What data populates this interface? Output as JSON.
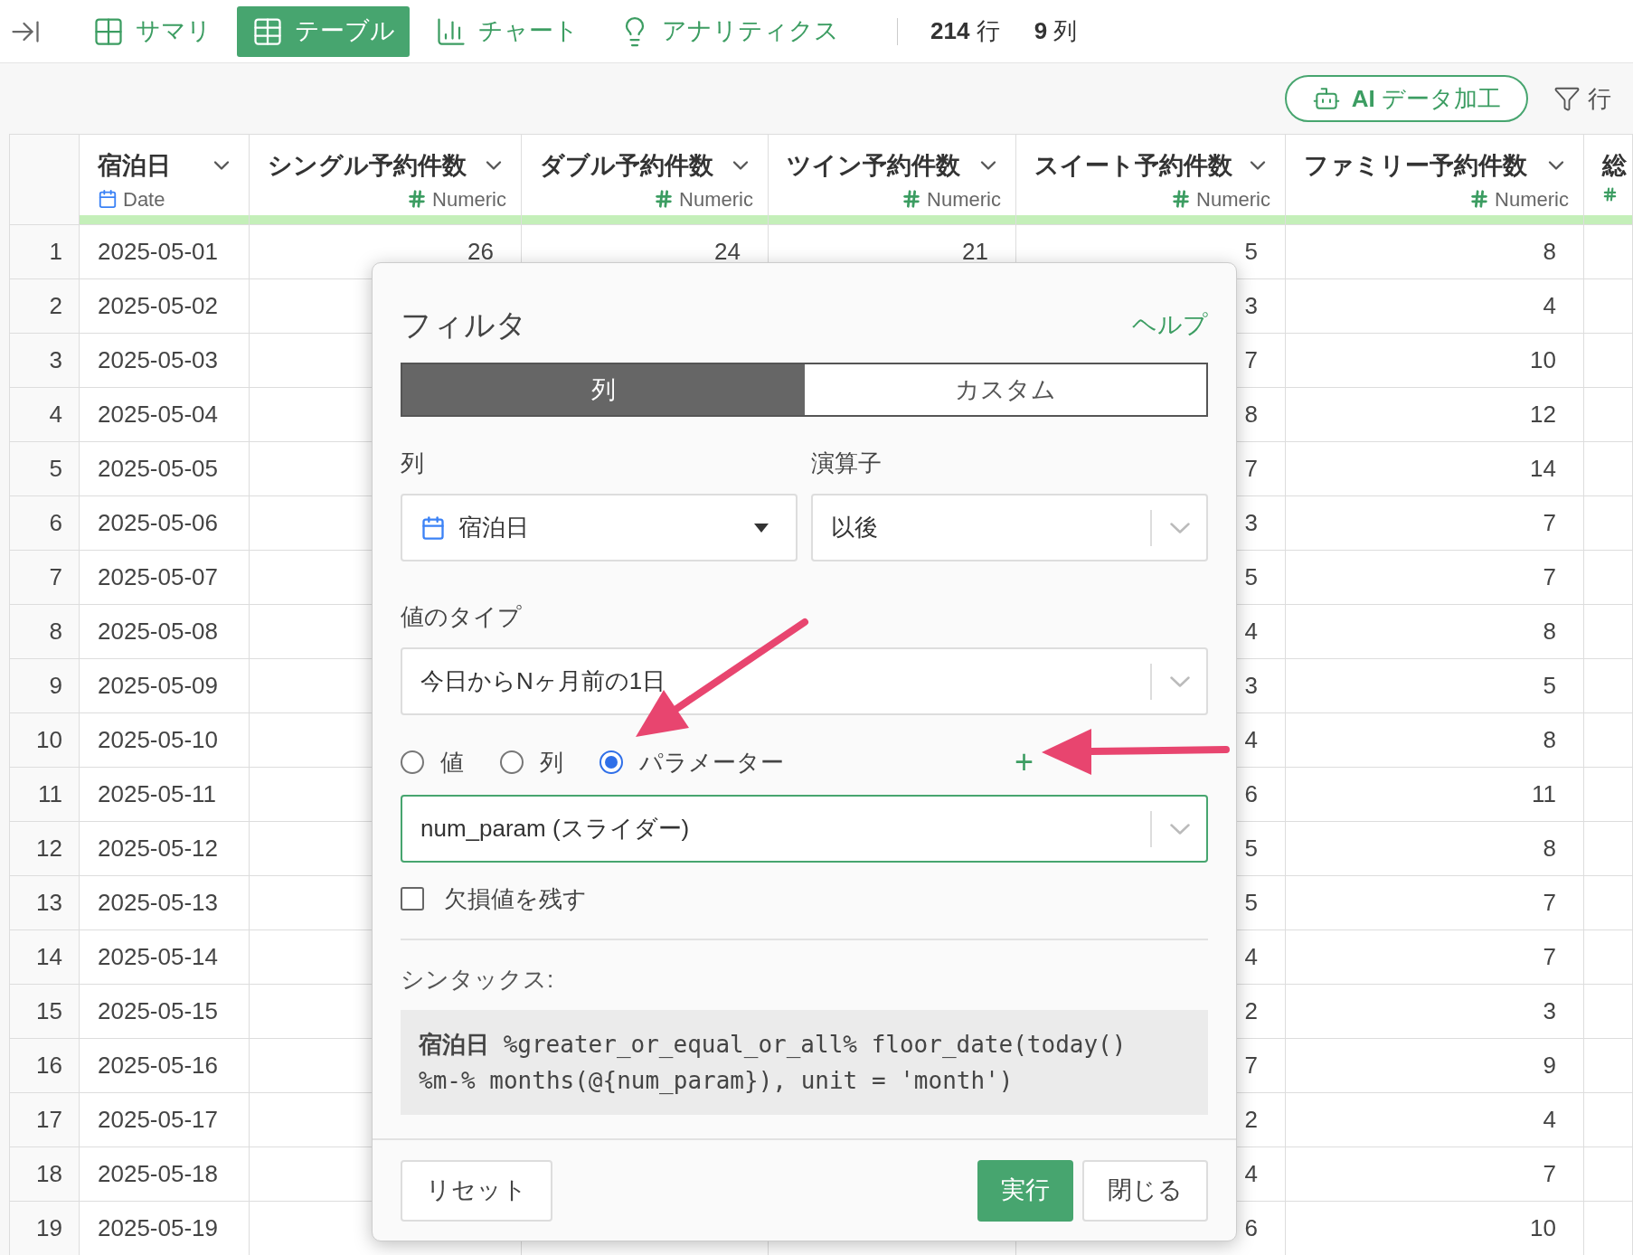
{
  "top_bar": {
    "tabs": [
      {
        "label": "サマリ",
        "selected": false
      },
      {
        "label": "テーブル",
        "selected": true
      },
      {
        "label": "チャート",
        "selected": false
      },
      {
        "label": "アナリティクス",
        "selected": false
      }
    ],
    "row_count": {
      "value": "214",
      "unit": "行"
    },
    "column_count": {
      "value": "9",
      "unit": "列"
    }
  },
  "toolbar": {
    "ai_button": "**AI** データ加工",
    "filter_button": "行"
  },
  "table": {
    "columns": [
      {
        "name": "宿泊日",
        "kind": "date",
        "type_label": "Date"
      },
      {
        "name": "シングル予約件数",
        "kind": "numeric",
        "type_label": "Numeric"
      },
      {
        "name": "ダブル予約件数",
        "kind": "numeric",
        "type_label": "Numeric"
      },
      {
        "name": "ツイン予約件数",
        "kind": "numeric",
        "type_label": "Numeric"
      },
      {
        "name": "スイート予約件数",
        "kind": "numeric",
        "type_label": "Numeric"
      },
      {
        "name": "ファミリー予約件数",
        "kind": "numeric",
        "type_label": "Numeric"
      },
      {
        "name": "総",
        "kind": "numeric"
      }
    ],
    "rows": [
      {
        "number": "1",
        "cells": [
          "2025-05-01",
          "26",
          "24",
          "21",
          "5",
          "8"
        ]
      },
      {
        "number": "2",
        "cells": [
          "2025-05-02",
          null,
          null,
          null,
          "3",
          "4"
        ]
      },
      {
        "number": "3",
        "cells": [
          "2025-05-03",
          null,
          null,
          null,
          "7",
          "10"
        ]
      },
      {
        "number": "4",
        "cells": [
          "2025-05-04",
          null,
          null,
          null,
          "8",
          "12"
        ]
      },
      {
        "number": "5",
        "cells": [
          "2025-05-05",
          null,
          null,
          null,
          "7",
          "14"
        ]
      },
      {
        "number": "6",
        "cells": [
          "2025-05-06",
          null,
          null,
          null,
          "3",
          "7"
        ]
      },
      {
        "number": "7",
        "cells": [
          "2025-05-07",
          null,
          null,
          null,
          "5",
          "7"
        ]
      },
      {
        "number": "8",
        "cells": [
          "2025-05-08",
          null,
          null,
          null,
          "4",
          "8"
        ]
      },
      {
        "number": "9",
        "cells": [
          "2025-05-09",
          null,
          null,
          null,
          "3",
          "5"
        ]
      },
      {
        "number": "10",
        "cells": [
          "2025-05-10",
          null,
          null,
          null,
          "4",
          "8"
        ]
      },
      {
        "number": "11",
        "cells": [
          "2025-05-11",
          null,
          null,
          null,
          "6",
          "11"
        ]
      },
      {
        "number": "12",
        "cells": [
          "2025-05-12",
          null,
          null,
          null,
          "5",
          "8"
        ]
      },
      {
        "number": "13",
        "cells": [
          "2025-05-13",
          null,
          null,
          null,
          "5",
          "7"
        ]
      },
      {
        "number": "14",
        "cells": [
          "2025-05-14",
          null,
          null,
          null,
          "4",
          "7"
        ]
      },
      {
        "number": "15",
        "cells": [
          "2025-05-15",
          null,
          null,
          null,
          "2",
          "3"
        ]
      },
      {
        "number": "16",
        "cells": [
          "2025-05-16",
          null,
          null,
          null,
          "7",
          "9"
        ]
      },
      {
        "number": "17",
        "cells": [
          "2025-05-17",
          null,
          null,
          null,
          "2",
          "4"
        ]
      },
      {
        "number": "18",
        "cells": [
          "2025-05-18",
          null,
          null,
          null,
          "4",
          "7"
        ]
      },
      {
        "number": "19",
        "cells": [
          "2025-05-19",
          null,
          null,
          null,
          "6",
          "10"
        ]
      }
    ]
  },
  "filter_dialog": {
    "title": "フィルタ",
    "help_link": "ヘルプ",
    "segments": [
      {
        "label": "列",
        "selected": true
      },
      {
        "label": "カスタム",
        "selected": false
      }
    ],
    "column_field": {
      "label": "列",
      "value": "宿泊日"
    },
    "operator_field": {
      "label": "演算子",
      "value": "以後"
    },
    "value_type_field": {
      "label": "値のタイプ",
      "value": "今日からNヶ月前の1日"
    },
    "source_options": [
      {
        "label": "値",
        "selected": false
      },
      {
        "label": "列",
        "selected": false
      },
      {
        "label": "パラメーター",
        "selected": true
      }
    ],
    "add_button": "+",
    "parameter_field": {
      "value": "num_param (スライダー)"
    },
    "keep_missing": {
      "label": "欠損値を残す",
      "checked": false
    },
    "syntax_label": "シンタックス:",
    "syntax": "**宿泊日** %greater_or_equal_or_all% floor_date(today() %m-% months(@{num_param}), unit = 'month')",
    "buttons": [
      {
        "label": "リセット",
        "kind": "secondary"
      },
      {
        "label": "実行",
        "kind": "primary"
      },
      {
        "label": "閉じる",
        "kind": "secondary"
      }
    ]
  },
  "annotations": [
    {
      "kind": "arrow"
    },
    {
      "kind": "arrow"
    }
  ]
}
